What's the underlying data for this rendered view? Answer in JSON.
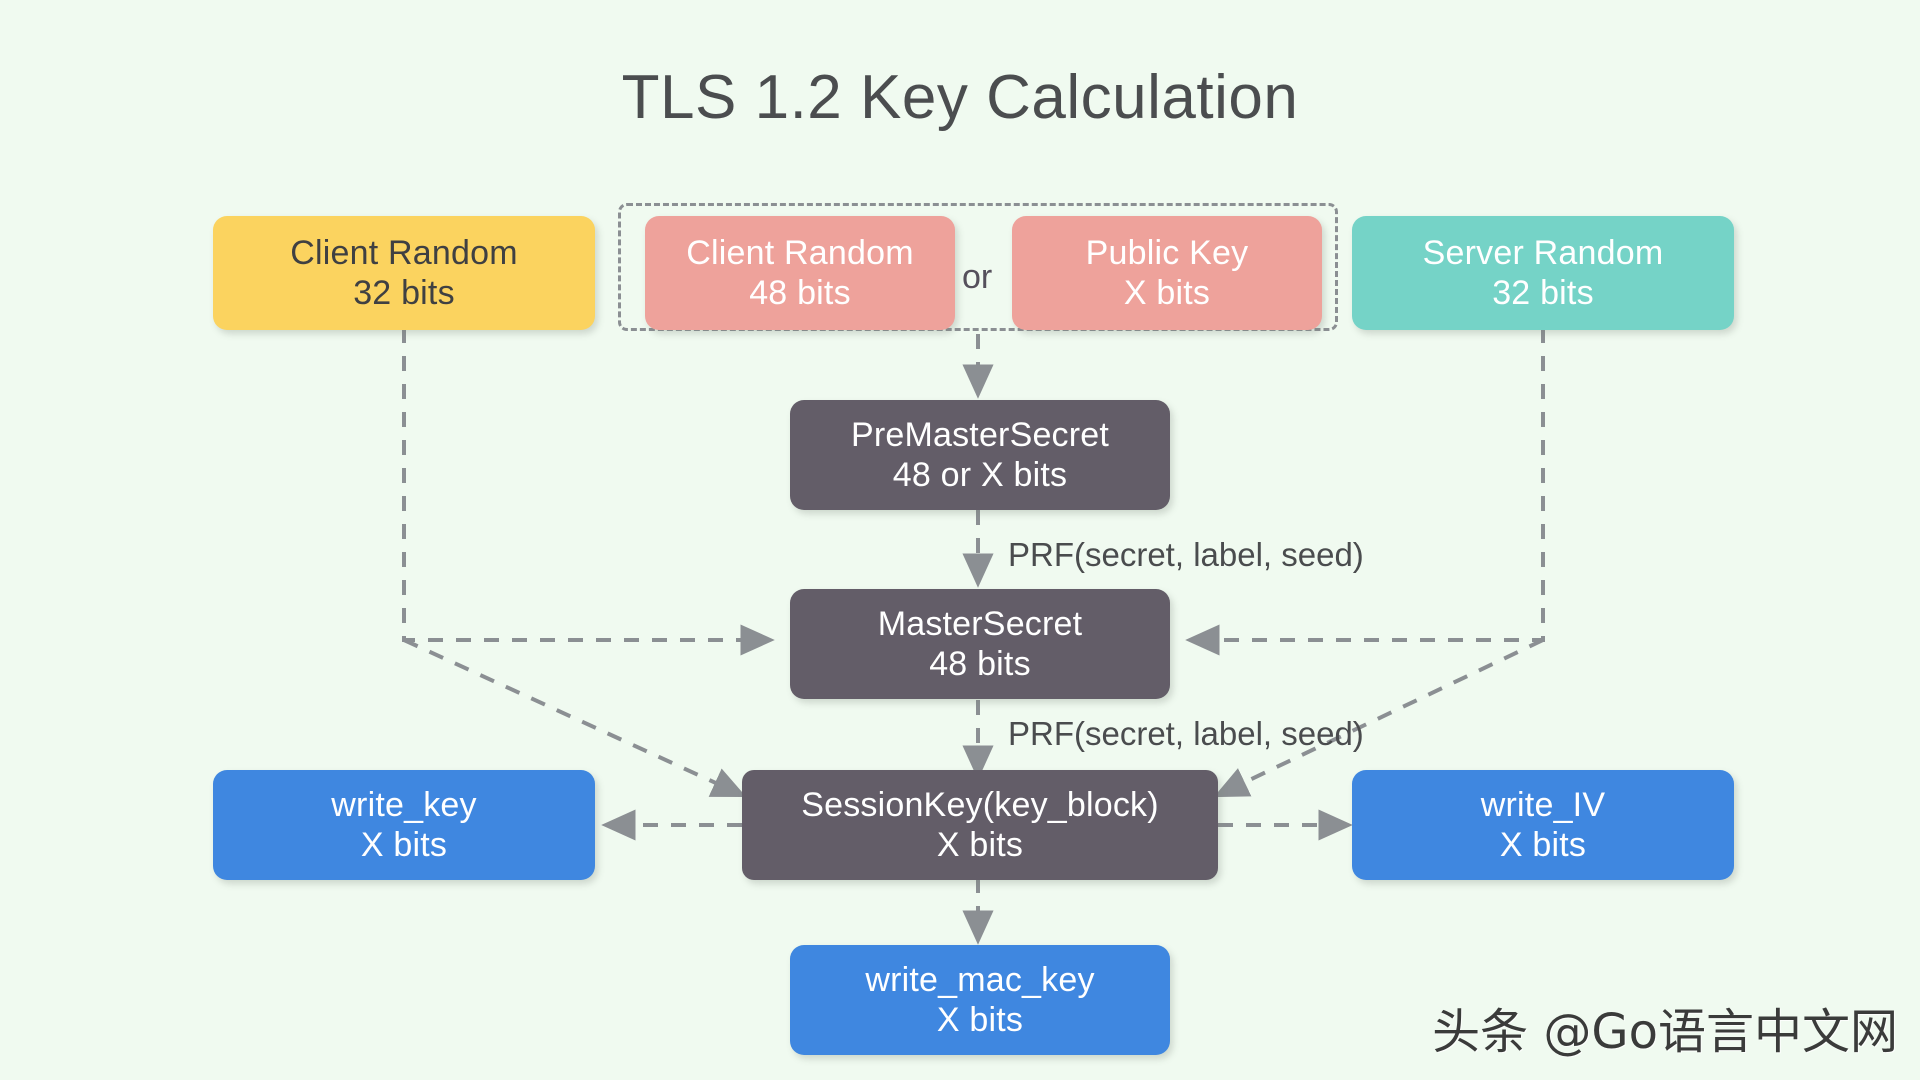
{
  "page": {
    "title": "TLS 1.2 Key Calculation",
    "background_color": "#f0faf0",
    "watermark": "头条 @Go语言中文网"
  },
  "colors": {
    "client_random_yellow": "#fbd35f",
    "pink": "#eea29b",
    "server_random_teal": "#75d3c7",
    "secret_gray": "#635d68",
    "output_blue": "#3f87e0",
    "connector_gray": "#8b8f93",
    "title_text": "#4b4d4f"
  },
  "nodes": {
    "client_random_32": {
      "line1": "Client Random",
      "line2": "32 bits"
    },
    "client_random_48": {
      "line1": "Client Random",
      "line2": "48 bits"
    },
    "public_key": {
      "line1": "Public Key",
      "line2": "X bits"
    },
    "server_random_32": {
      "line1": "Server Random",
      "line2": "32 bits"
    },
    "premastersecret": {
      "line1": "PreMasterSecret",
      "line2": "48 or X bits"
    },
    "mastersecret": {
      "line1": "MasterSecret",
      "line2": "48 bits"
    },
    "sessionkey": {
      "line1": "SessionKey(key_block)",
      "line2": "X bits"
    },
    "write_key": {
      "line1": "write_key",
      "line2": "X bits"
    },
    "write_iv": {
      "line1": "write_IV",
      "line2": "X bits"
    },
    "write_mac_key": {
      "line1": "write_mac_key",
      "line2": "X bits"
    }
  },
  "labels": {
    "or": "or",
    "prf_master": "PRF(secret, label, seed)",
    "prf_session": "PRF(secret, label, seed)"
  },
  "chart_data": {
    "type": "diagram",
    "title": "TLS 1.2 Key Calculation",
    "nodes": [
      {
        "id": "client_random_32",
        "label": "Client Random\n32 bits",
        "color": "#fbd35f"
      },
      {
        "id": "client_random_48",
        "label": "Client Random\n48 bits",
        "color": "#eea29b"
      },
      {
        "id": "public_key",
        "label": "Public Key\nX bits",
        "color": "#eea29b"
      },
      {
        "id": "server_random_32",
        "label": "Server Random\n32 bits",
        "color": "#75d3c7"
      },
      {
        "id": "premastersecret",
        "label": "PreMasterSecret\n48 or X bits",
        "color": "#635d68"
      },
      {
        "id": "mastersecret",
        "label": "MasterSecret\n48 bits",
        "color": "#635d68"
      },
      {
        "id": "sessionkey",
        "label": "SessionKey(key_block)\nX bits",
        "color": "#635d68"
      },
      {
        "id": "write_key",
        "label": "write_key\nX bits",
        "color": "#3f87e0"
      },
      {
        "id": "write_iv",
        "label": "write_IV\nX bits",
        "color": "#3f87e0"
      },
      {
        "id": "write_mac_key",
        "label": "write_mac_key\nX bits",
        "color": "#3f87e0"
      }
    ],
    "groups": [
      {
        "members": [
          "client_random_48",
          "public_key"
        ],
        "separator": "or",
        "style": "dashed"
      }
    ],
    "edges": [
      {
        "from": "or_group",
        "to": "premastersecret",
        "label": "",
        "style": "dashed"
      },
      {
        "from": "premastersecret",
        "to": "mastersecret",
        "label": "PRF(secret, label, seed)",
        "style": "dashed"
      },
      {
        "from": "client_random_32",
        "to": "mastersecret",
        "label": "",
        "style": "dashed"
      },
      {
        "from": "server_random_32",
        "to": "mastersecret",
        "label": "",
        "style": "dashed"
      },
      {
        "from": "client_random_32",
        "to": "sessionkey",
        "label": "",
        "style": "dashed"
      },
      {
        "from": "server_random_32",
        "to": "sessionkey",
        "label": "",
        "style": "dashed"
      },
      {
        "from": "mastersecret",
        "to": "sessionkey",
        "label": "PRF(secret, label, seed)",
        "style": "dashed"
      },
      {
        "from": "sessionkey",
        "to": "write_key",
        "label": "",
        "style": "dashed"
      },
      {
        "from": "sessionkey",
        "to": "write_iv",
        "label": "",
        "style": "dashed"
      },
      {
        "from": "sessionkey",
        "to": "write_mac_key",
        "label": "",
        "style": "dashed"
      }
    ]
  }
}
